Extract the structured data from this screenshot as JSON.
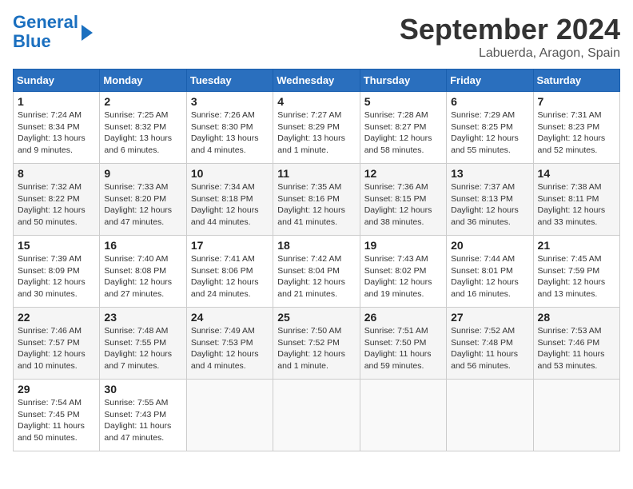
{
  "header": {
    "logo_line1": "General",
    "logo_line2": "Blue",
    "month": "September 2024",
    "location": "Labuerda, Aragon, Spain"
  },
  "weekdays": [
    "Sunday",
    "Monday",
    "Tuesday",
    "Wednesday",
    "Thursday",
    "Friday",
    "Saturday"
  ],
  "weeks": [
    [
      {
        "day": "1",
        "info": "Sunrise: 7:24 AM\nSunset: 8:34 PM\nDaylight: 13 hours\nand 9 minutes."
      },
      {
        "day": "2",
        "info": "Sunrise: 7:25 AM\nSunset: 8:32 PM\nDaylight: 13 hours\nand 6 minutes."
      },
      {
        "day": "3",
        "info": "Sunrise: 7:26 AM\nSunset: 8:30 PM\nDaylight: 13 hours\nand 4 minutes."
      },
      {
        "day": "4",
        "info": "Sunrise: 7:27 AM\nSunset: 8:29 PM\nDaylight: 13 hours\nand 1 minute."
      },
      {
        "day": "5",
        "info": "Sunrise: 7:28 AM\nSunset: 8:27 PM\nDaylight: 12 hours\nand 58 minutes."
      },
      {
        "day": "6",
        "info": "Sunrise: 7:29 AM\nSunset: 8:25 PM\nDaylight: 12 hours\nand 55 minutes."
      },
      {
        "day": "7",
        "info": "Sunrise: 7:31 AM\nSunset: 8:23 PM\nDaylight: 12 hours\nand 52 minutes."
      }
    ],
    [
      {
        "day": "8",
        "info": "Sunrise: 7:32 AM\nSunset: 8:22 PM\nDaylight: 12 hours\nand 50 minutes."
      },
      {
        "day": "9",
        "info": "Sunrise: 7:33 AM\nSunset: 8:20 PM\nDaylight: 12 hours\nand 47 minutes."
      },
      {
        "day": "10",
        "info": "Sunrise: 7:34 AM\nSunset: 8:18 PM\nDaylight: 12 hours\nand 44 minutes."
      },
      {
        "day": "11",
        "info": "Sunrise: 7:35 AM\nSunset: 8:16 PM\nDaylight: 12 hours\nand 41 minutes."
      },
      {
        "day": "12",
        "info": "Sunrise: 7:36 AM\nSunset: 8:15 PM\nDaylight: 12 hours\nand 38 minutes."
      },
      {
        "day": "13",
        "info": "Sunrise: 7:37 AM\nSunset: 8:13 PM\nDaylight: 12 hours\nand 36 minutes."
      },
      {
        "day": "14",
        "info": "Sunrise: 7:38 AM\nSunset: 8:11 PM\nDaylight: 12 hours\nand 33 minutes."
      }
    ],
    [
      {
        "day": "15",
        "info": "Sunrise: 7:39 AM\nSunset: 8:09 PM\nDaylight: 12 hours\nand 30 minutes."
      },
      {
        "day": "16",
        "info": "Sunrise: 7:40 AM\nSunset: 8:08 PM\nDaylight: 12 hours\nand 27 minutes."
      },
      {
        "day": "17",
        "info": "Sunrise: 7:41 AM\nSunset: 8:06 PM\nDaylight: 12 hours\nand 24 minutes."
      },
      {
        "day": "18",
        "info": "Sunrise: 7:42 AM\nSunset: 8:04 PM\nDaylight: 12 hours\nand 21 minutes."
      },
      {
        "day": "19",
        "info": "Sunrise: 7:43 AM\nSunset: 8:02 PM\nDaylight: 12 hours\nand 19 minutes."
      },
      {
        "day": "20",
        "info": "Sunrise: 7:44 AM\nSunset: 8:01 PM\nDaylight: 12 hours\nand 16 minutes."
      },
      {
        "day": "21",
        "info": "Sunrise: 7:45 AM\nSunset: 7:59 PM\nDaylight: 12 hours\nand 13 minutes."
      }
    ],
    [
      {
        "day": "22",
        "info": "Sunrise: 7:46 AM\nSunset: 7:57 PM\nDaylight: 12 hours\nand 10 minutes."
      },
      {
        "day": "23",
        "info": "Sunrise: 7:48 AM\nSunset: 7:55 PM\nDaylight: 12 hours\nand 7 minutes."
      },
      {
        "day": "24",
        "info": "Sunrise: 7:49 AM\nSunset: 7:53 PM\nDaylight: 12 hours\nand 4 minutes."
      },
      {
        "day": "25",
        "info": "Sunrise: 7:50 AM\nSunset: 7:52 PM\nDaylight: 12 hours\nand 1 minute."
      },
      {
        "day": "26",
        "info": "Sunrise: 7:51 AM\nSunset: 7:50 PM\nDaylight: 11 hours\nand 59 minutes."
      },
      {
        "day": "27",
        "info": "Sunrise: 7:52 AM\nSunset: 7:48 PM\nDaylight: 11 hours\nand 56 minutes."
      },
      {
        "day": "28",
        "info": "Sunrise: 7:53 AM\nSunset: 7:46 PM\nDaylight: 11 hours\nand 53 minutes."
      }
    ],
    [
      {
        "day": "29",
        "info": "Sunrise: 7:54 AM\nSunset: 7:45 PM\nDaylight: 11 hours\nand 50 minutes."
      },
      {
        "day": "30",
        "info": "Sunrise: 7:55 AM\nSunset: 7:43 PM\nDaylight: 11 hours\nand 47 minutes."
      },
      null,
      null,
      null,
      null,
      null
    ]
  ]
}
